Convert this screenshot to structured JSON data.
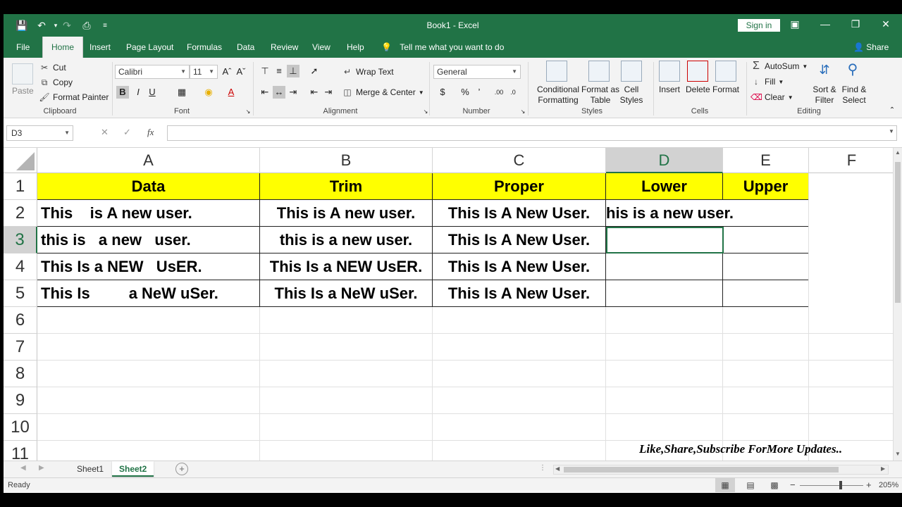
{
  "window": {
    "title": "Book1  -  Excel",
    "sign_in": "Sign in",
    "share": "Share"
  },
  "tabs": [
    "File",
    "Home",
    "Insert",
    "Page Layout",
    "Formulas",
    "Data",
    "Review",
    "View",
    "Help"
  ],
  "tell_me": "Tell me what you want to do",
  "ribbon": {
    "clipboard": {
      "label": "Clipboard",
      "paste": "Paste",
      "cut": "Cut",
      "copy": "Copy",
      "format_painter": "Format Painter"
    },
    "font": {
      "label": "Font",
      "name": "Calibri",
      "size": "11",
      "bold": "B",
      "italic": "I",
      "underline": "U"
    },
    "alignment": {
      "label": "Alignment",
      "wrap_text": "Wrap Text",
      "merge_center": "Merge & Center"
    },
    "number": {
      "label": "Number",
      "format": "General",
      "currency": "$",
      "percent": "%",
      "comma": "’"
    },
    "styles": {
      "label": "Styles",
      "conditional_1": "Conditional",
      "conditional_2": "Formatting",
      "format_as_1": "Format as",
      "format_as_2": "Table",
      "cell_styles_1": "Cell",
      "cell_styles_2": "Styles"
    },
    "cells": {
      "label": "Cells",
      "insert": "Insert",
      "delete": "Delete",
      "format": "Format"
    },
    "editing": {
      "label": "Editing",
      "autosum": "AutoSum",
      "fill": "Fill",
      "clear": "Clear",
      "sort_1": "Sort &",
      "sort_2": "Filter",
      "find_1": "Find &",
      "find_2": "Select"
    }
  },
  "formula_bar": {
    "name_box": "D3",
    "fx": "fx",
    "value": ""
  },
  "columns": [
    "A",
    "B",
    "C",
    "D",
    "E",
    "F"
  ],
  "rows": [
    "1",
    "2",
    "3",
    "4",
    "5",
    "6",
    "7",
    "8",
    "9",
    "10",
    "11"
  ],
  "cells": {
    "header": [
      "Data",
      "Trim",
      "Proper",
      "Lower",
      "Upper"
    ],
    "data": [
      [
        "This    is A new user.",
        "This is A new user.",
        "This Is A New User.",
        "his is a new user."
      ],
      [
        "this is   a new   user.",
        "this is a new user.",
        "This Is A New User."
      ],
      [
        "This Is a NEW   UsER.",
        "This Is a NEW UsER.",
        "This Is A New User."
      ],
      [
        "This Is         a NeW uSer.",
        "This Is a NeW uSer.",
        "This Is A New User."
      ]
    ]
  },
  "watermark": "Like,Share,Subscribe ForMore Updates..",
  "sheets": [
    "Sheet1",
    "Sheet2"
  ],
  "status": {
    "ready": "Ready",
    "zoom": "205%"
  }
}
